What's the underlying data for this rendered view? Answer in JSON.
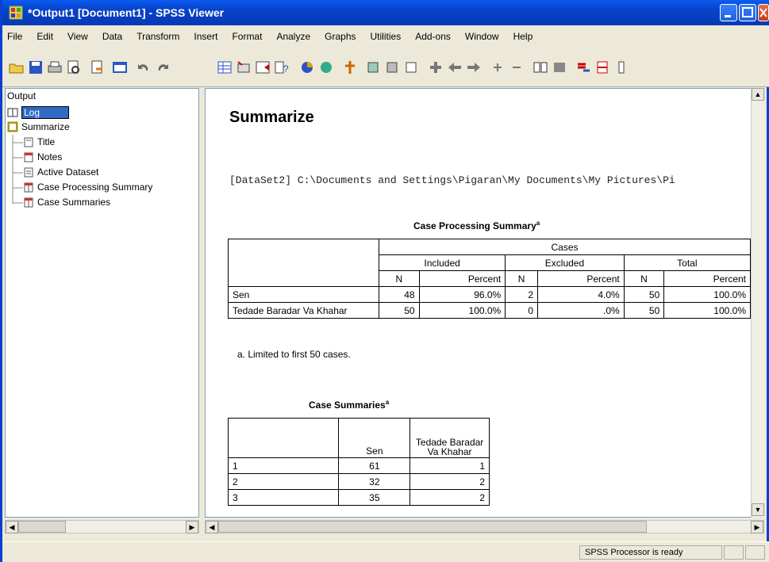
{
  "window": {
    "title": "*Output1 [Document1] - SPSS Viewer"
  },
  "menu": [
    "File",
    "Edit",
    "View",
    "Data",
    "Transform",
    "Insert",
    "Format",
    "Analyze",
    "Graphs",
    "Utilities",
    "Add-ons",
    "Window",
    "Help"
  ],
  "tree": {
    "root": "Output",
    "items": [
      {
        "label": "Log"
      },
      {
        "label": "Summarize"
      },
      {
        "label": "Title"
      },
      {
        "label": "Notes"
      },
      {
        "label": "Active Dataset"
      },
      {
        "label": "Case Processing Summary"
      },
      {
        "label": "Case Summaries"
      }
    ]
  },
  "content": {
    "heading": "Summarize",
    "dataset_line": "[DataSet2] C:\\Documents and Settings\\Pigaran\\My Documents\\My Pictures\\Pi",
    "cps": {
      "title": "Case Processing Summary",
      "superscript": "a",
      "cases_label": "Cases",
      "groups": [
        "Included",
        "Excluded",
        "Total"
      ],
      "subheads": [
        "N",
        "Percent",
        "N",
        "Percent",
        "N",
        "Percent"
      ],
      "rows": [
        {
          "label": "Sen",
          "values": [
            "48",
            "96.0%",
            "2",
            "4.0%",
            "50",
            "100.0%"
          ]
        },
        {
          "label": "Tedade Baradar Va Khahar",
          "values": [
            "50",
            "100.0%",
            "0",
            ".0%",
            "50",
            "100.0%"
          ]
        }
      ],
      "footnote": "a. Limited to first 50 cases."
    },
    "cs": {
      "title": "Case Summaries",
      "superscript": "a",
      "col1": "Sen",
      "col2": "Tedade Baradar Va Khahar",
      "rows": [
        {
          "n": "1",
          "sen": "61",
          "tb": "1"
        },
        {
          "n": "2",
          "sen": "32",
          "tb": "2"
        },
        {
          "n": "3",
          "sen": "35",
          "tb": "2"
        }
      ]
    }
  },
  "status": {
    "text": "SPSS  Processor is ready"
  },
  "colors": {
    "titlebar": "#0841C9",
    "chrome": "#ECE9D8"
  }
}
